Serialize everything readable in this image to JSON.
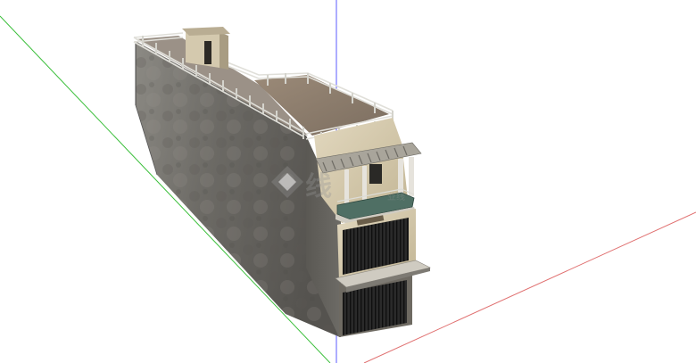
{
  "viewport": {
    "background": "#ffffff",
    "axis_colors": {
      "x": "#e05a5a",
      "y": "#3cbf3c",
      "z": "#4a4aff"
    }
  },
  "model": {
    "wall_color": "#77756f",
    "facade_color": "#d8cdb3",
    "grille_color": "#1c1c1c",
    "railing_color": "#d9d9d4",
    "roof_color": "#8f7f6e",
    "glass_color": "#4f6f64"
  },
  "watermark": {
    "text": "线",
    "sub": "业线",
    "icon": "diamond-logo-icon"
  }
}
